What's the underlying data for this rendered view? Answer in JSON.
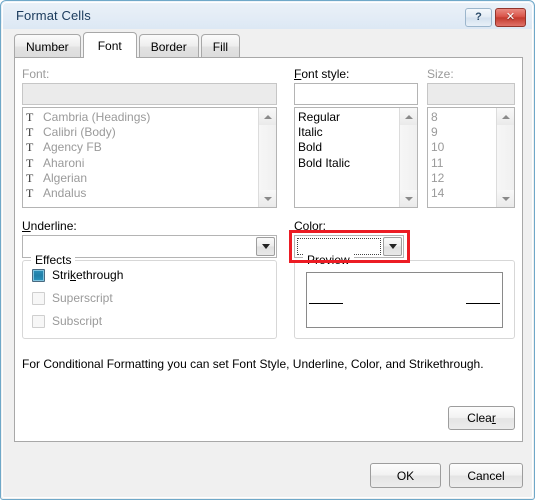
{
  "window": {
    "title": "Format Cells",
    "help_button": "?",
    "close_button": "✕"
  },
  "tabs": [
    {
      "label": "Number",
      "active": false
    },
    {
      "label": "Font",
      "active": true
    },
    {
      "label": "Border",
      "active": false
    },
    {
      "label": "Fill",
      "active": false
    }
  ],
  "font_section": {
    "label": "Font:",
    "enabled": false,
    "input_value": "",
    "items": [
      {
        "name": "Cambria (Headings)",
        "icon": "truetype-icon"
      },
      {
        "name": "Calibri (Body)",
        "icon": "truetype-icon"
      },
      {
        "name": "Agency FB",
        "icon": "truetype-icon"
      },
      {
        "name": "Aharoni",
        "icon": "truetype-icon"
      },
      {
        "name": "Algerian",
        "icon": "truetype-icon"
      },
      {
        "name": "Andalus",
        "icon": "truetype-icon"
      }
    ]
  },
  "font_style_section": {
    "label": "Font style:",
    "accelerator": "o",
    "enabled": true,
    "input_value": "",
    "items": [
      "Regular",
      "Italic",
      "Bold",
      "Bold Italic"
    ]
  },
  "size_section": {
    "label": "Size:",
    "enabled": false,
    "input_value": "",
    "items": [
      "8",
      "9",
      "10",
      "11",
      "12",
      "14"
    ]
  },
  "underline_section": {
    "label": "Underline:",
    "accelerator": "U",
    "value": "",
    "enabled": true
  },
  "color_section": {
    "label": "Color:",
    "accelerator": "C",
    "value": "",
    "enabled": true,
    "focused": true,
    "highlight_color": "#ec1c24"
  },
  "effects": {
    "label": "Effects",
    "items": [
      {
        "label": "Strikethrough",
        "checked": true,
        "enabled": true,
        "accel_index": 5
      },
      {
        "label": "Superscript",
        "checked": false,
        "enabled": false,
        "accel_index": -1
      },
      {
        "label": "Subscript",
        "checked": false,
        "enabled": false,
        "accel_index": -1
      }
    ]
  },
  "preview": {
    "label": "Preview",
    "sample_text": ""
  },
  "description": "For Conditional Formatting you can set Font Style, Underline, Color, and Strikethrough.",
  "buttons": {
    "clear": "Clear",
    "clear_accel": "r",
    "ok": "OK",
    "cancel": "Cancel"
  }
}
